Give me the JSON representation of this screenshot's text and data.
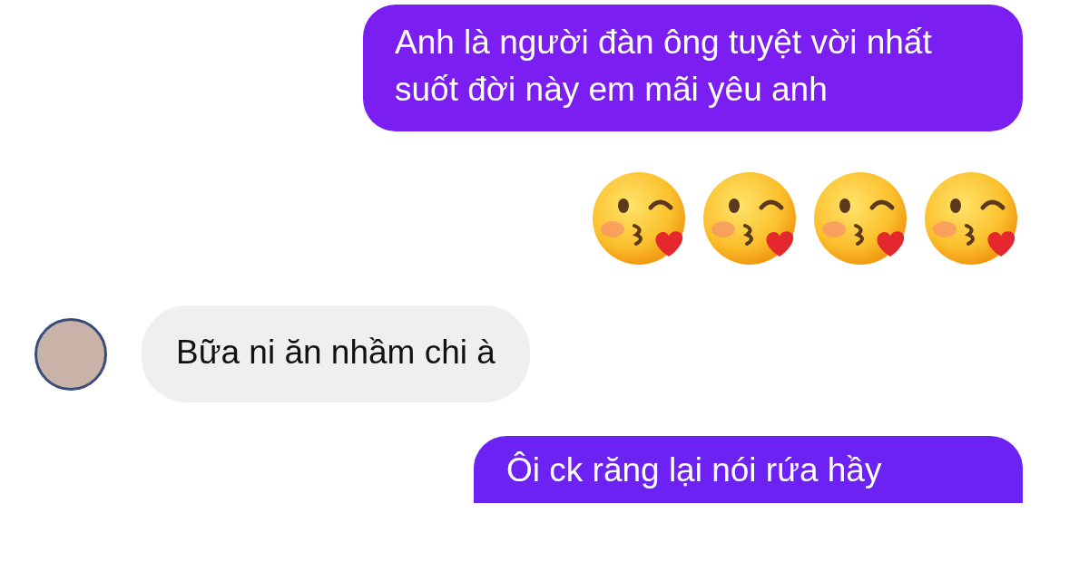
{
  "messages": [
    {
      "kind": "sent",
      "text": "Anh là người đàn ông tuyệt vời nhất suốt đời này em mãi yêu anh"
    },
    {
      "kind": "emoji",
      "emojis": [
        {
          "kind": "kiss-heart"
        },
        {
          "kind": "kiss-heart"
        },
        {
          "kind": "kiss-heart"
        },
        {
          "kind": "kiss-heart"
        }
      ]
    },
    {
      "kind": "received",
      "text": "Bữa ni ăn nhầm chi à"
    },
    {
      "kind": "sent",
      "text": "Ôi ck răng lại nói rứa hầy"
    }
  ]
}
